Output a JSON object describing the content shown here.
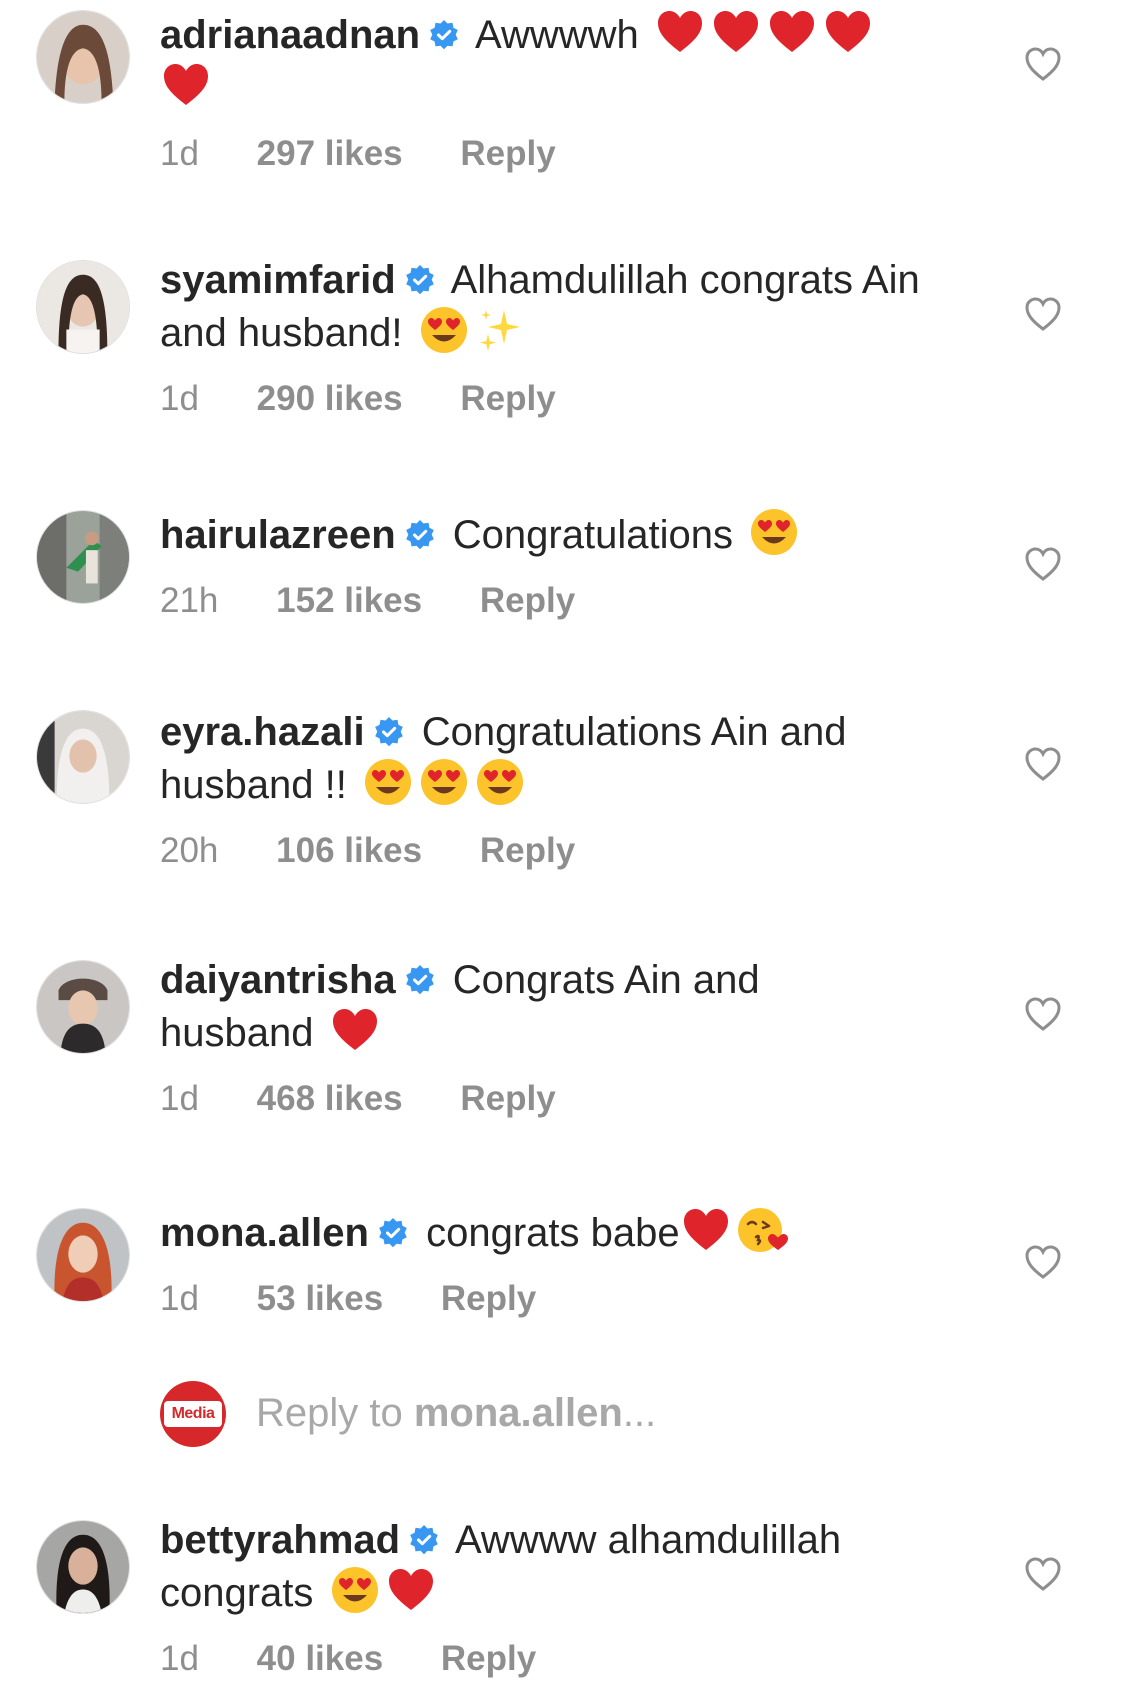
{
  "comments": [
    {
      "username": "adrianaadnan",
      "text": "Awwwwh",
      "emojis": [
        "red-heart",
        "red-heart",
        "red-heart",
        "red-heart",
        "red-heart"
      ],
      "time": "1d",
      "likes": "297 likes",
      "reply": "Reply",
      "avatar_color": "#8a6b5c"
    },
    {
      "username": "syamimfarid",
      "text": "Alhamdulillah congrats Ain and husband!",
      "emojis": [
        "heart-eyes",
        "sparkles"
      ],
      "time": "1d",
      "likes": "290 likes",
      "reply": "Reply",
      "avatar_color": "#c9c2bd"
    },
    {
      "username": "hairulazreen",
      "text": "Congratulations",
      "emojis": [
        "heart-eyes"
      ],
      "time": "21h",
      "likes": "152 likes",
      "reply": "Reply",
      "avatar_color": "#6e7a5e"
    },
    {
      "username": "eyra.hazali",
      "text": "Congratulations Ain and husband !!",
      "emojis": [
        "heart-eyes",
        "heart-eyes",
        "heart-eyes"
      ],
      "time": "20h",
      "likes": "106 likes",
      "reply": "Reply",
      "avatar_color": "#b7b1ad"
    },
    {
      "username": "daiyantrisha",
      "text": "Congrats Ain and husband",
      "emojis": [
        "red-heart"
      ],
      "time": "1d",
      "likes": "468 likes",
      "reply": "Reply",
      "avatar_color": "#7c6f6a"
    },
    {
      "username": "mona.allen",
      "text": "congrats babe",
      "emojis": [
        "red-heart",
        "kissing-heart"
      ],
      "time": "1d",
      "likes": "53 likes",
      "reply": "Reply",
      "avatar_color": "#b5543c"
    },
    {
      "username": "bettyrahmad",
      "text": "Awwww alhamdulillah congrats",
      "emojis": [
        "heart-eyes",
        "red-heart"
      ],
      "time": "1d",
      "likes": "40 likes",
      "reply": "Reply",
      "avatar_color": "#4a4340"
    }
  ],
  "reply_box": {
    "avatar_label": "Media",
    "placeholder_prefix": "Reply to ",
    "placeholder_user": "mona.allen",
    "placeholder_suffix": "..."
  },
  "colors": {
    "verified": "#3897f0",
    "secondary_text": "#8e8e8e",
    "primary_text": "#262626",
    "heart_outline": "#8e8e8e"
  }
}
